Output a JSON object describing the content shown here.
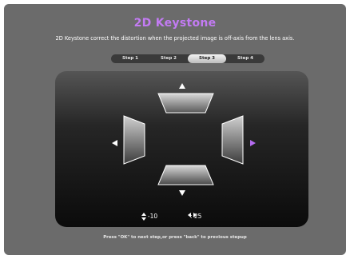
{
  "title": "2D Keystone",
  "description": "2D Keystone correct the distortion when the projected image is off-axis from the lens axis.",
  "steps": [
    "Step 1",
    "Step 2",
    "Step 3",
    "Step 4"
  ],
  "active_step": "Step 3",
  "readouts": {
    "vertical_value": ": -10",
    "horizontal_value": ": 25"
  },
  "hint": "Press \"OK\" to next step,or press \"back\" to previous stepup",
  "colors": {
    "title": "#c37bf4",
    "highlight_arrow": "#b56cf0",
    "background": "#6b6b6b"
  },
  "icons": {
    "up": "triangle-up-icon",
    "down": "triangle-down-icon",
    "left": "triangle-left-icon",
    "right": "triangle-right-icon",
    "vertical": "up-down-arrows-icon",
    "horizontal": "left-right-arrows-icon"
  }
}
